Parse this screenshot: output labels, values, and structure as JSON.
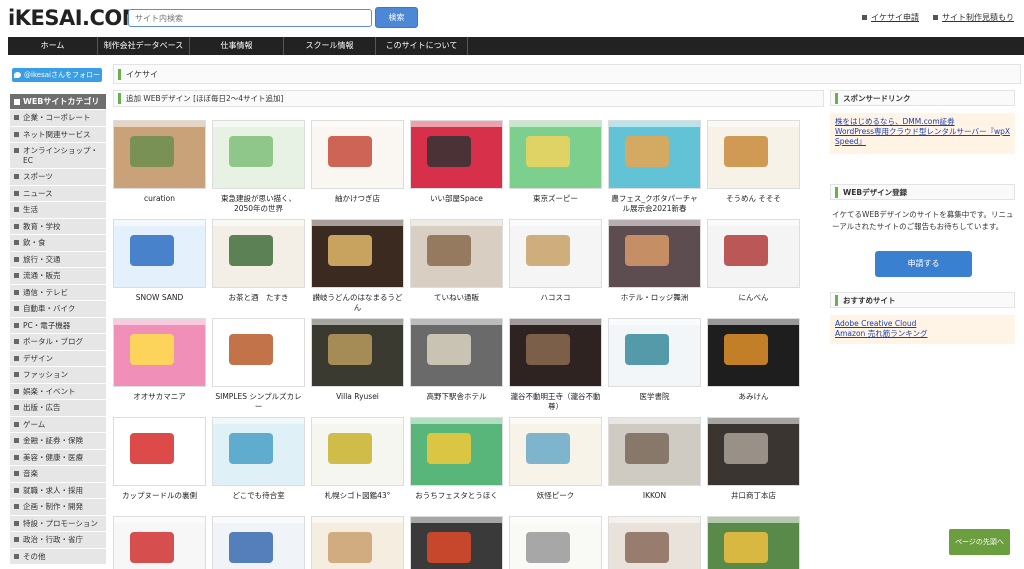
{
  "header": {
    "logo": "iKESAI.COM",
    "search_placeholder": "サイト内検索",
    "search_button": "検索",
    "links": [
      "イケサイ申請",
      "サイト制作見積もり"
    ]
  },
  "nav": {
    "items": [
      "ホーム",
      "制作会社データベース",
      "仕事情報",
      "スクール情報",
      "このサイトについて"
    ]
  },
  "sidebar": {
    "follow_label": "@ikesaiさんをフォロー",
    "category_title": "WEBサイトカテゴリ",
    "categories": [
      "企業・コーポレート",
      "ネット関連サービス",
      "オンラインショップ・EC",
      "スポーツ",
      "ニュース",
      "生活",
      "教育・学校",
      "飲・食",
      "旅行・交通",
      "流通・販売",
      "通信・テレビ",
      "自動車・バイク",
      "PC・電子機器",
      "ポータル・ブログ",
      "デザイン",
      "ファッション",
      "娯楽・イベント",
      "出版・広告",
      "ゲーム",
      "金融・証券・保険",
      "美容・健康・医療",
      "音楽",
      "就職・求人・採用",
      "企画・制作・開発",
      "特設・プロモーション",
      "政治・行政・省庁",
      "その他"
    ]
  },
  "main": {
    "breadcrumb": "イケサイ",
    "section_title": "追加 WEBデザイン [ほぼ毎日2～4サイト追加]",
    "cards": [
      {
        "title": "curation",
        "bg": "#c9a27a",
        "accent": "#6b8e4e"
      },
      {
        "title": "東急建設が思い描く、2050年の世界",
        "bg": "#e8f2e4",
        "accent": "#7fbf7a"
      },
      {
        "title": "紬かけつぎ店",
        "bg": "#faf7f2",
        "accent": "#c44a3a"
      },
      {
        "title": "いい部屋Space",
        "bg": "#d6304a",
        "accent": "#333333"
      },
      {
        "title": "東京ズーピー",
        "bg": "#7ccf8c",
        "accent": "#f1d35e"
      },
      {
        "title": "農フェス_クボタパーチャル展示会2021新春",
        "bg": "#62c3d6",
        "accent": "#e9a64f"
      },
      {
        "title": "そうめん そそそ",
        "bg": "#f7f2e8",
        "accent": "#c98b3b"
      },
      {
        "title": "SNOW SAND",
        "bg": "#e4f0fb",
        "accent": "#2c6ec2"
      },
      {
        "title": "お茶と酒　たすき",
        "bg": "#f3efe6",
        "accent": "#3f6d3a"
      },
      {
        "title": "讃岐うどんのはなまるうどん",
        "bg": "#3b2a20",
        "accent": "#e0b86b"
      },
      {
        "title": "ていねい通販",
        "bg": "#d8cfc2",
        "accent": "#8a6b4e"
      },
      {
        "title": "ハコスコ",
        "bg": "#f5f5f5",
        "accent": "#c9a066"
      },
      {
        "title": "ホテル・ロッジ舞洲",
        "bg": "#5d4c50",
        "accent": "#d89a68"
      },
      {
        "title": "にんべん",
        "bg": "#f4f4f4",
        "accent": "#b23b3b"
      },
      {
        "title": "オオサカマニア",
        "bg": "#f08fb8",
        "accent": "#ffe14a"
      },
      {
        "title": "SIMPLES シンプルズカレー",
        "bg": "#ffffff",
        "accent": "#b85a2a"
      },
      {
        "title": "Villa Ryusei",
        "bg": "#3a3a30",
        "accent": "#b89a5c"
      },
      {
        "title": "高野下駅舎ホテル",
        "bg": "#6a6a6a",
        "accent": "#d9d2c0"
      },
      {
        "title": "瀧谷不動明王寺（瀧谷不動尊）",
        "bg": "#2e2320",
        "accent": "#8a6a50"
      },
      {
        "title": "医学書院",
        "bg": "#f2f6f8",
        "accent": "#3a8a9a"
      },
      {
        "title": "あみけん",
        "bg": "#1e1e1e",
        "accent": "#e0902a"
      },
      {
        "title": "カップヌードルの裏側",
        "bg": "#ffffff",
        "accent": "#d62a2a"
      },
      {
        "title": "どこでも待合室",
        "bg": "#dff0f7",
        "accent": "#4aa0c8"
      },
      {
        "title": "札幌シゴト図鑑43°",
        "bg": "#f6f6f0",
        "accent": "#c9b22a"
      },
      {
        "title": "おうちフェスタとうほく",
        "bg": "#58b67a",
        "accent": "#f1c93a"
      },
      {
        "title": "妖怪ピーク",
        "bg": "#f7f3e8",
        "accent": "#6aa8c8"
      },
      {
        "title": "IKKON",
        "bg": "#cfcac2",
        "accent": "#7a6a5a"
      },
      {
        "title": "井口商丁本店",
        "bg": "#3a3530",
        "accent": "#aaa098"
      },
      {
        "title": "",
        "bg": "#f7f7f7",
        "accent": "#d03030"
      },
      {
        "title": "",
        "bg": "#f0f4f8",
        "accent": "#3a6ab0"
      },
      {
        "title": "",
        "bg": "#f5eee0",
        "accent": "#caa070"
      },
      {
        "title": "",
        "bg": "#3a3a3a",
        "accent": "#e04a2a"
      },
      {
        "title": "",
        "bg": "#f9f9f6",
        "accent": "#999999"
      },
      {
        "title": "",
        "bg": "#e8e2da",
        "accent": "#8a6a5a"
      },
      {
        "title": "",
        "bg": "#5a8a4a",
        "accent": "#f0c040"
      }
    ]
  },
  "right": {
    "sponsor_title": "スポンサードリンク",
    "sponsor_links": [
      "株をはじめるなら、DMM.com証券",
      "WordPress専用クラウド型レンタルサーバー『wpX Speed』"
    ],
    "register_title": "WEBデザイン登録",
    "register_text": "イケてるWEBデザインのサイトを募集中です。リニューアルされたサイトのご報告もお待ちしています。",
    "apply_button": "申請する",
    "recommend_title": "おすすめサイト",
    "recommend_links": [
      "Adobe Creative Cloud",
      "Amazon 売れ筋ランキング"
    ],
    "pagetop": "ページの先頭へ"
  }
}
